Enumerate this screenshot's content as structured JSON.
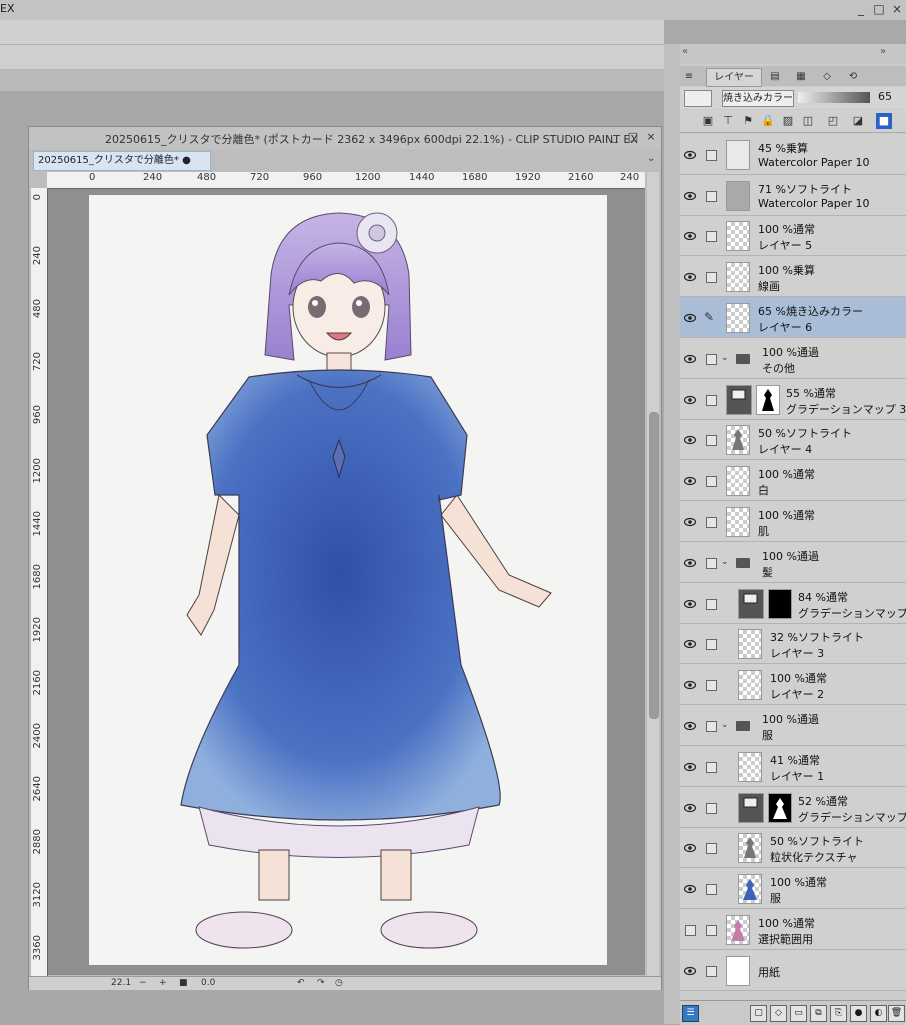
{
  "app": {
    "title_fragment": "EX",
    "window_buttons": [
      "_",
      "□",
      "×"
    ]
  },
  "canvas_window": {
    "title": "20250615_クリスタで分離色* (ポストカード 2362 x 3496px 600dpi 22.1%)  - CLIP STUDIO PAINT EX",
    "tab_label": "20250615_クリスタで分離色*  ●",
    "ruler_h": [
      "0",
      "240",
      "480",
      "720",
      "960",
      "1200",
      "1440",
      "1680",
      "1920",
      "2160",
      "240"
    ],
    "ruler_v": [
      "0",
      "240",
      "480",
      "720",
      "960",
      "1200",
      "1440",
      "1680",
      "1920",
      "2160",
      "2400",
      "2640",
      "2880",
      "3120",
      "3360"
    ],
    "zoom": "22.1",
    "rotation": "0.0"
  },
  "layer_panel": {
    "tab_label": "レイヤー",
    "blend_mode": "焼き込みカラー",
    "opacity": "65",
    "layers": [
      {
        "mode": "45 %乗算",
        "name": "Watercolor Paper 10",
        "thumb": "paper",
        "visible": true
      },
      {
        "mode": "71 %ソフトライト",
        "name": "Watercolor Paper 10",
        "thumb": "paper-dark",
        "visible": true
      },
      {
        "mode": "100 %通常",
        "name": "レイヤー 5",
        "thumb": "checker",
        "visible": true
      },
      {
        "mode": "100 %乗算",
        "name": "線画",
        "thumb": "lineart",
        "visible": true
      },
      {
        "mode": "65 %焼き込みカラー",
        "name": "レイヤー 6",
        "thumb": "checker",
        "visible": true,
        "selected": true
      },
      {
        "mode": "100 %通過",
        "name": "その他",
        "thumb": "folder",
        "visible": true
      },
      {
        "mode": "55 %通常",
        "name": "グラデーションマップ 3",
        "thumb": "gradmap",
        "visible": true
      },
      {
        "mode": "50 %ソフトライト",
        "name": "レイヤー 4",
        "thumb": "figure",
        "visible": true
      },
      {
        "mode": "100 %通常",
        "name": "白",
        "thumb": "checker",
        "visible": true
      },
      {
        "mode": "100 %通常",
        "name": "肌",
        "thumb": "checker",
        "visible": true
      },
      {
        "mode": "100 %通過",
        "name": "髪",
        "thumb": "folder",
        "visible": true
      },
      {
        "mode": "84 %通常",
        "name": "グラデーションマップ 2",
        "thumb": "gradmap-black",
        "visible": true,
        "indent": true
      },
      {
        "mode": "32 %ソフトライト",
        "name": "レイヤー 3",
        "thumb": "checker",
        "visible": true,
        "indent": true
      },
      {
        "mode": "100 %通常",
        "name": "レイヤー 2",
        "thumb": "checker",
        "visible": true,
        "indent": true
      },
      {
        "mode": "100 %通過",
        "name": "服",
        "thumb": "folder",
        "visible": true
      },
      {
        "mode": "41 %通常",
        "name": "レイヤー 1",
        "thumb": "checker",
        "visible": true,
        "indent": true
      },
      {
        "mode": "52 %通常",
        "name": "グラデーションマップ 1",
        "thumb": "gradmap-dress",
        "visible": true,
        "indent": true
      },
      {
        "mode": "50 %ソフトライト",
        "name": "粒状化テクスチャ",
        "thumb": "figure",
        "visible": true,
        "indent": true
      },
      {
        "mode": "100 %通常",
        "name": "服",
        "thumb": "dress-blue",
        "visible": true,
        "indent": true
      },
      {
        "mode": "100 %通常",
        "name": "選択範囲用",
        "thumb": "pink",
        "visible": false
      },
      {
        "mode": "",
        "name": "用紙",
        "thumb": "white",
        "visible": true
      }
    ]
  },
  "colors": {
    "selected_row": "#a9bed6",
    "dress_blue": "#3d62b8",
    "hair_purple": "#a78ad6"
  }
}
